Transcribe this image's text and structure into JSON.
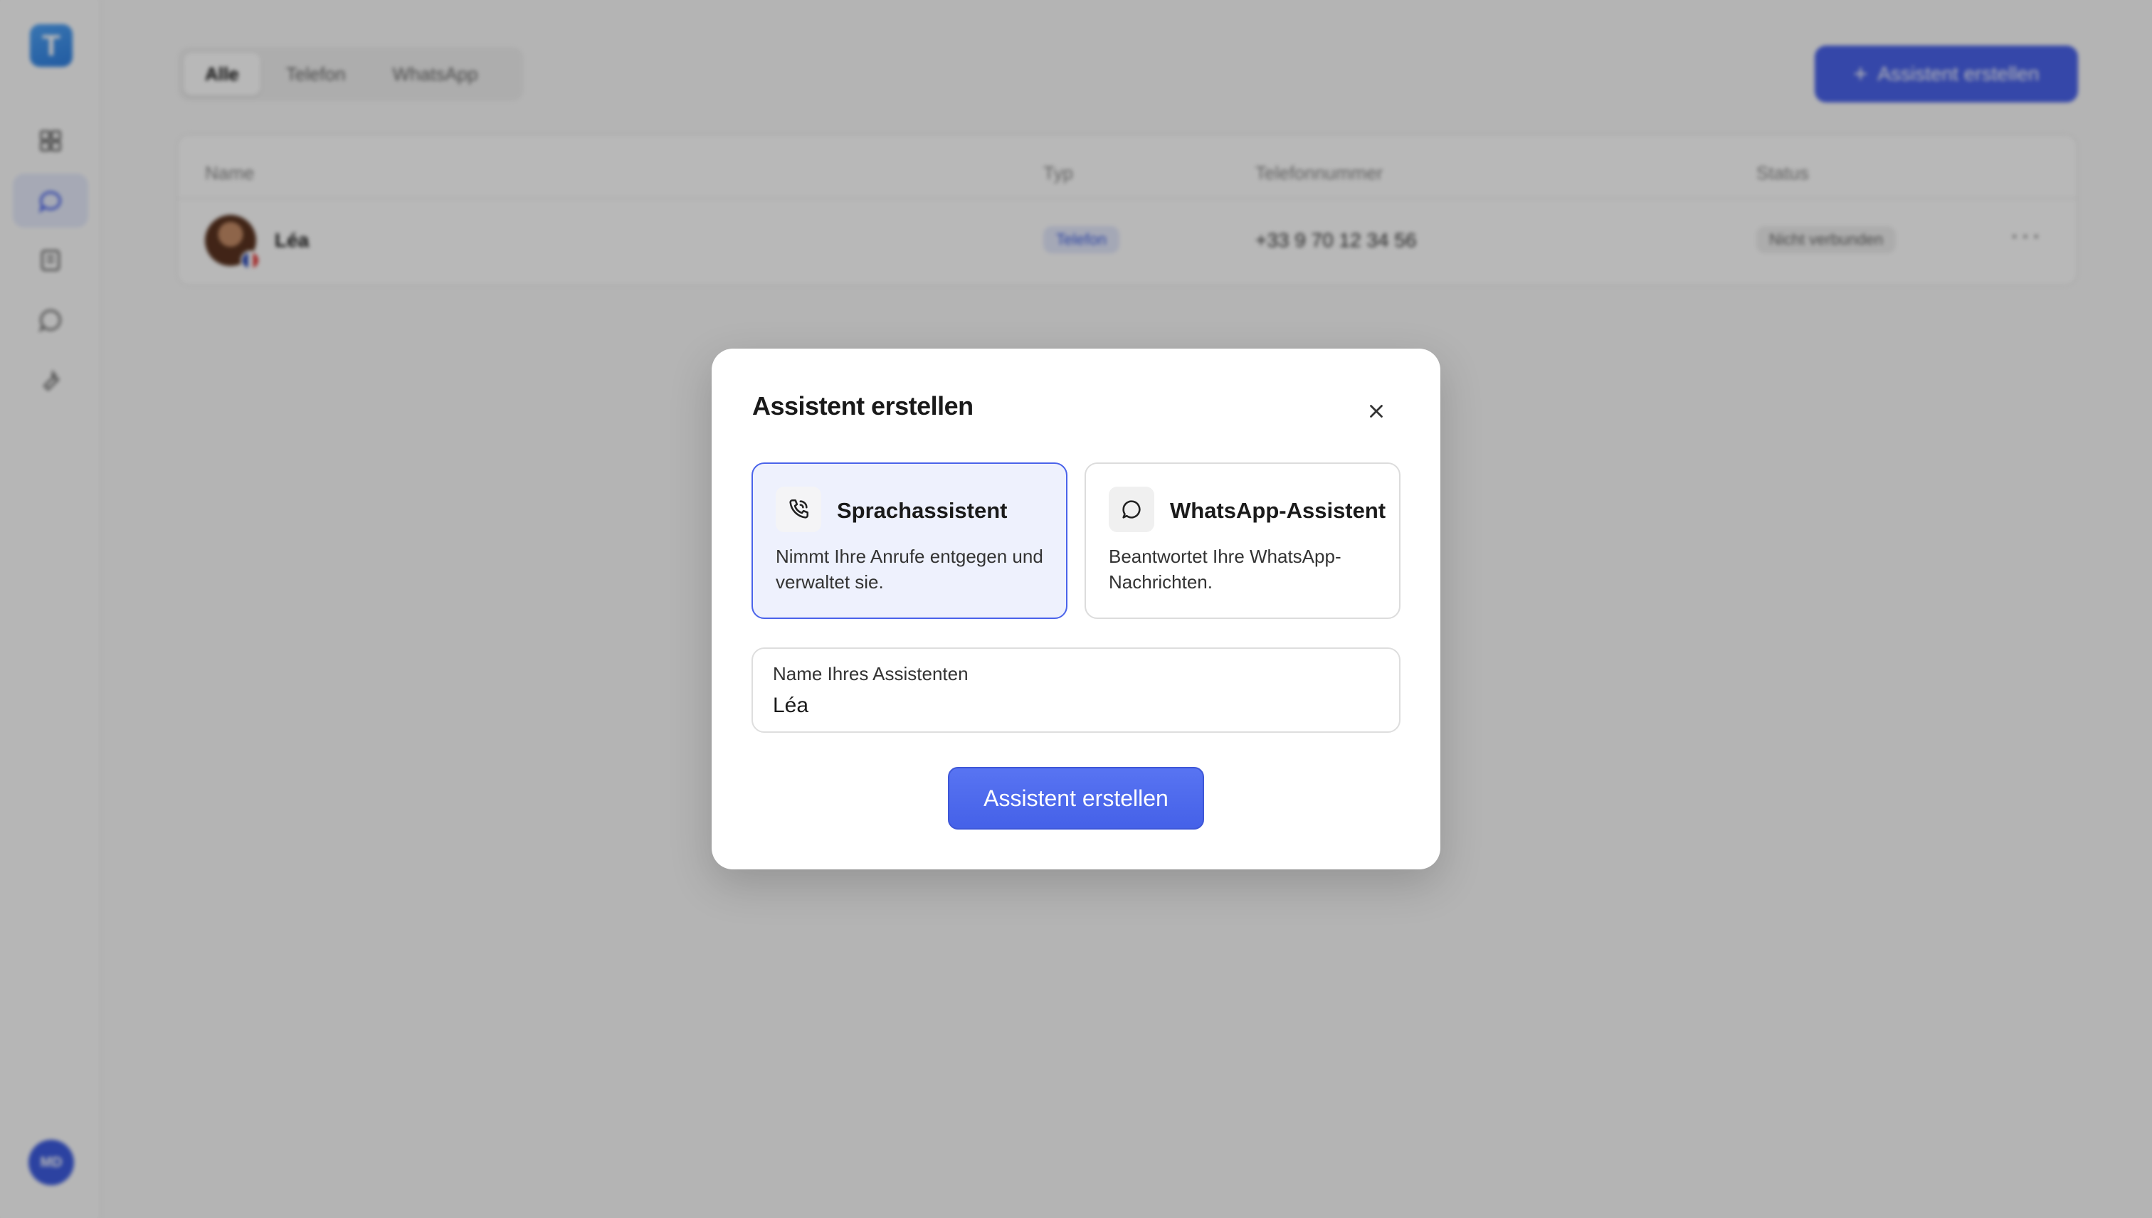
{
  "app": {
    "logo_letter": "T",
    "user_initials": "MD"
  },
  "filters": {
    "tabs": [
      "Alle",
      "Telefon",
      "WhatsApp"
    ]
  },
  "header": {
    "create_label": "Assistent erstellen"
  },
  "table": {
    "columns": [
      "Name",
      "Typ",
      "Telefonnummer",
      "Status"
    ],
    "rows": [
      {
        "name": "Léa",
        "type": "Telefon",
        "phone": "+33 9 70 12 34 56",
        "status": "Nicht verbunden"
      }
    ]
  },
  "modal": {
    "title": "Assistent erstellen",
    "options": [
      {
        "title": "Sprachassistent",
        "description": "Nimmt Ihre Anrufe entgegen und verwaltet sie.",
        "icon": "phone-call-icon"
      },
      {
        "title": "WhatsApp-Assistent",
        "description": "Beantwortet Ihre WhatsApp-Nachrichten.",
        "icon": "chat-bubble-icon"
      }
    ],
    "name_field": {
      "label": "Name Ihres Assistenten",
      "value": "Léa"
    },
    "submit_label": "Assistent erstellen"
  },
  "colors": {
    "accent": "#4a63ea",
    "selected_bg": "#eef1fd"
  }
}
